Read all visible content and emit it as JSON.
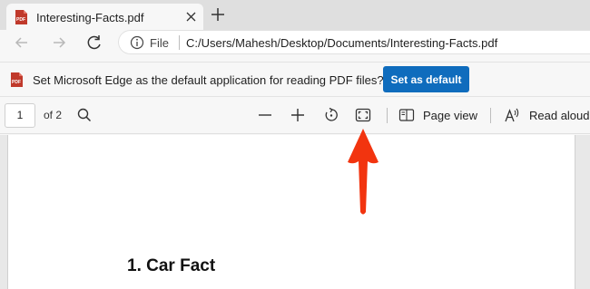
{
  "tab": {
    "title": "Interesting-Facts.pdf"
  },
  "address": {
    "scheme": "File",
    "url": "C:/Users/Mahesh/Desktop/Documents/Interesting-Facts.pdf"
  },
  "infobar": {
    "message": "Set Microsoft Edge as the default application for reading PDF files?",
    "button_label": "Set as default"
  },
  "pdf_toolbar": {
    "page_number": "1",
    "page_count": "of 2",
    "page_view_label": "Page view",
    "read_aloud_label": "Read aloud"
  },
  "document": {
    "heading": "1. Car Fact"
  },
  "colors": {
    "accent": "#0f6cbd",
    "arrow": "#f2340f",
    "pdf_icon": "#c0392b"
  }
}
